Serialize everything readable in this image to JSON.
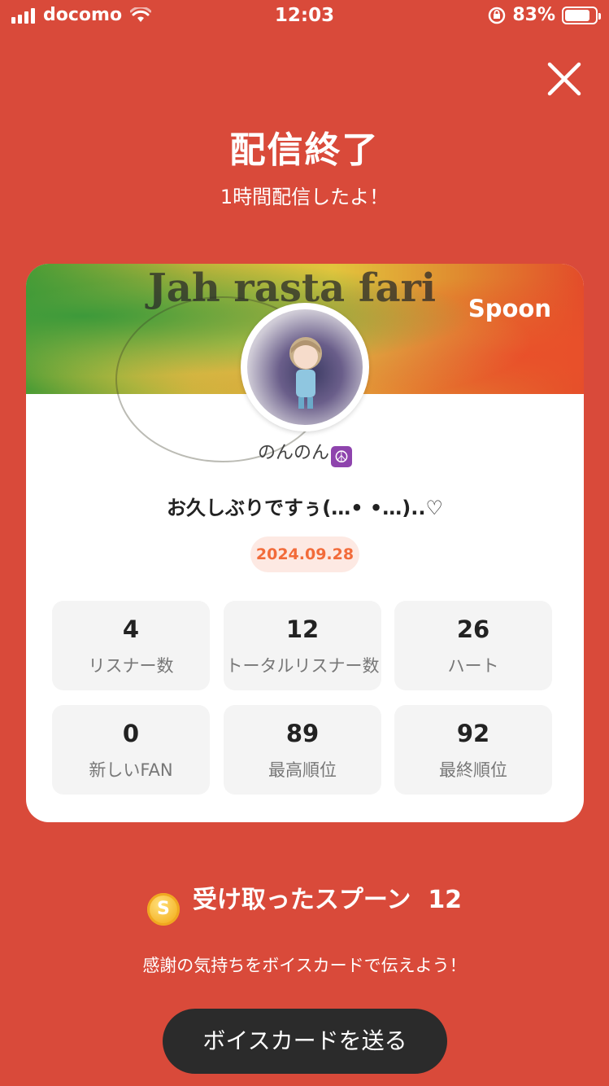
{
  "status_bar": {
    "carrier": "docomo",
    "time": "12:03",
    "battery_percent": "83%",
    "battery_level": 0.83,
    "icons": [
      "signal-icon",
      "wifi-icon",
      "orientation-lock-icon",
      "battery-icon"
    ]
  },
  "header": {
    "close_icon": "close-icon",
    "title": "配信終了",
    "subtitle": "1時間配信したよ！"
  },
  "card": {
    "banner_text": "Jah rasta fari",
    "brand": "Spoon",
    "username": "のんのん",
    "username_emoji": "☮",
    "headline": "お久しぶりですぅ(…• •…)..♡",
    "date": "2024.09.28",
    "stats": [
      {
        "value": "4",
        "label": "リスナー数"
      },
      {
        "value": "12",
        "label": "トータルリスナー数"
      },
      {
        "value": "26",
        "label": "ハート"
      },
      {
        "value": "0",
        "label": "新しいFAN"
      },
      {
        "value": "89",
        "label": "最高順位"
      },
      {
        "value": "92",
        "label": "最終順位"
      }
    ]
  },
  "spoons": {
    "coin_symbol": "S",
    "label": "受け取ったスプーン",
    "count": "12"
  },
  "thanks_text": "感謝の気持ちをボイスカードで伝えよう！",
  "voice_card_button": "ボイスカードを送る",
  "colors": {
    "background": "#d94a3a",
    "card": "#ffffff",
    "date_pill_bg": "#fde9e3",
    "date_pill_text": "#f26b3a",
    "button": "#2b2b2b"
  }
}
